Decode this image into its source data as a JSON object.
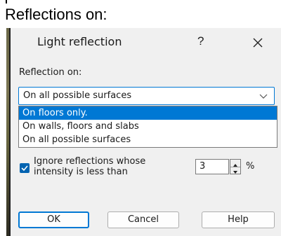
{
  "heading": "Reflections on:",
  "dialog": {
    "title": "Light reflection",
    "help_label": "?",
    "close_icon": "close-icon",
    "reflection_label": "Reflection on:",
    "combo": {
      "value": "On all possible surfaces",
      "icon": "chevron-down-icon"
    },
    "dropdown": {
      "options": [
        {
          "label": "On floors only.",
          "selected": true
        },
        {
          "label": "On walls, floors and slabs",
          "selected": false
        },
        {
          "label": "On all possible surfaces",
          "selected": false
        }
      ]
    },
    "ignore": {
      "checked": true,
      "label_line1": "Ignore reflections whose",
      "label_line2": "intensity is less than",
      "value": "3",
      "unit": "%"
    },
    "buttons": {
      "ok": "OK",
      "cancel": "Cancel",
      "help": "Help"
    },
    "accent_color": "#0078d4"
  }
}
